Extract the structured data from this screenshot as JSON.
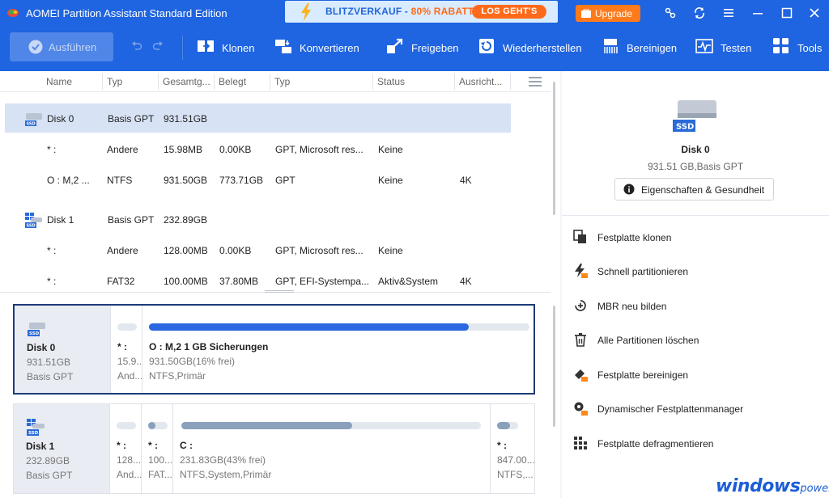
{
  "titlebar": {
    "title": "AOMEI Partition Assistant Standard Edition",
    "promo": {
      "text": "BLITZVERKAUF - ",
      "highlight": "80% RABATT",
      "button": "LOS GEHT'S"
    },
    "upgrade": "Upgrade",
    "icons": [
      "link-icon",
      "refresh-icon",
      "menu-icon",
      "minimize-icon",
      "maximize-icon",
      "close-icon"
    ]
  },
  "toolbar": {
    "apply": "Ausführen",
    "tools": [
      {
        "label": "Klonen",
        "icon": "clone-icon"
      },
      {
        "label": "Konvertieren",
        "icon": "convert-icon"
      },
      {
        "label": "Freigeben",
        "icon": "free-up-icon"
      },
      {
        "label": "Wiederherstellen",
        "icon": "recover-icon"
      },
      {
        "label": "Bereinigen",
        "icon": "wipe-icon"
      },
      {
        "label": "Testen",
        "icon": "test-icon"
      },
      {
        "label": "Tools",
        "icon": "tools-icon"
      }
    ]
  },
  "table": {
    "headers": [
      "Name",
      "Typ",
      "Gesamtg...",
      "Belegt",
      "Typ",
      "Status",
      "Ausricht..."
    ],
    "rows": [
      {
        "kind": "disk",
        "name": "Disk 0",
        "typ": "Basis GPT",
        "size": "931.51GB",
        "used": "",
        "fs": "",
        "status": "",
        "align": ""
      },
      {
        "kind": "part",
        "name": "* :",
        "typ": "Andere",
        "size": "15.98MB",
        "used": "0.00KB",
        "fs": "GPT, Microsoft res...",
        "status": "Keine",
        "align": ""
      },
      {
        "kind": "part",
        "name": "O : M,2 ...",
        "typ": "NTFS",
        "size": "931.50GB",
        "used": "773.71GB",
        "fs": "GPT",
        "status": "Keine",
        "align": "4K"
      },
      {
        "kind": "disk",
        "name": "Disk 1",
        "typ": "Basis GPT",
        "size": "232.89GB",
        "used": "",
        "fs": "",
        "status": "",
        "align": ""
      },
      {
        "kind": "part",
        "name": "* :",
        "typ": "Andere",
        "size": "128.00MB",
        "used": "0.00KB",
        "fs": "GPT, Microsoft res...",
        "status": "Keine",
        "align": ""
      },
      {
        "kind": "part",
        "name": "* :",
        "typ": "FAT32",
        "size": "100.00MB",
        "used": "37.80MB",
        "fs": "GPT, EFI-Systempa...",
        "status": "Aktiv&System",
        "align": "4K"
      }
    ]
  },
  "diskmap": {
    "disk0": {
      "name": "Disk 0",
      "size": "931.51GB",
      "style": "Basis GPT",
      "parts": [
        {
          "label": "* :",
          "size": "15.9...",
          "type": "And...",
          "fill": 0,
          "color": "#c9d3e0"
        },
        {
          "label": "O : M,2 1 GB Sicherungen",
          "size": "931.50GB(16% frei)",
          "type": "NTFS,Primär",
          "fill": 0.84,
          "color": "#2b67e0"
        }
      ]
    },
    "disk1": {
      "name": "Disk 1",
      "size": "232.89GB",
      "style": "Basis GPT",
      "parts": [
        {
          "label": "* :",
          "size": "128...",
          "type": "And...",
          "fill": 0,
          "color": "#c9d3e0"
        },
        {
          "label": "* :",
          "size": "100...",
          "type": "FAT...",
          "fill": 0.38,
          "color": "#8aa0bb"
        },
        {
          "label": "C :",
          "size": "231.83GB(43% frei)",
          "type": "NTFS,System,Primär",
          "fill": 0.57,
          "color": "#8aa0bb"
        },
        {
          "label": "* :",
          "size": "847.00...",
          "type": "NTFS,...",
          "fill": 0.6,
          "color": "#8aa0bb"
        }
      ]
    }
  },
  "details": {
    "name": "Disk 0",
    "size": "931.51 GB,Basis GPT",
    "props_button": "Eigenschaften & Gesundheit",
    "operations": [
      {
        "label": "Festplatte klonen",
        "icon": "clone-disk-icon"
      },
      {
        "label": "Schnell partitionieren",
        "icon": "quick-partition-icon"
      },
      {
        "label": "MBR neu bilden",
        "icon": "rebuild-mbr-icon"
      },
      {
        "label": "Alle Partitionen löschen",
        "icon": "trash-icon"
      },
      {
        "label": "Festplatte bereinigen",
        "icon": "wipe-disk-icon"
      },
      {
        "label": "Dynamischer Festplattenmanager",
        "icon": "dynamic-disk-icon"
      },
      {
        "label": "Festplatte defragmentieren",
        "icon": "defrag-icon"
      }
    ]
  },
  "watermark": {
    "main": "windows",
    "sub": "power"
  }
}
